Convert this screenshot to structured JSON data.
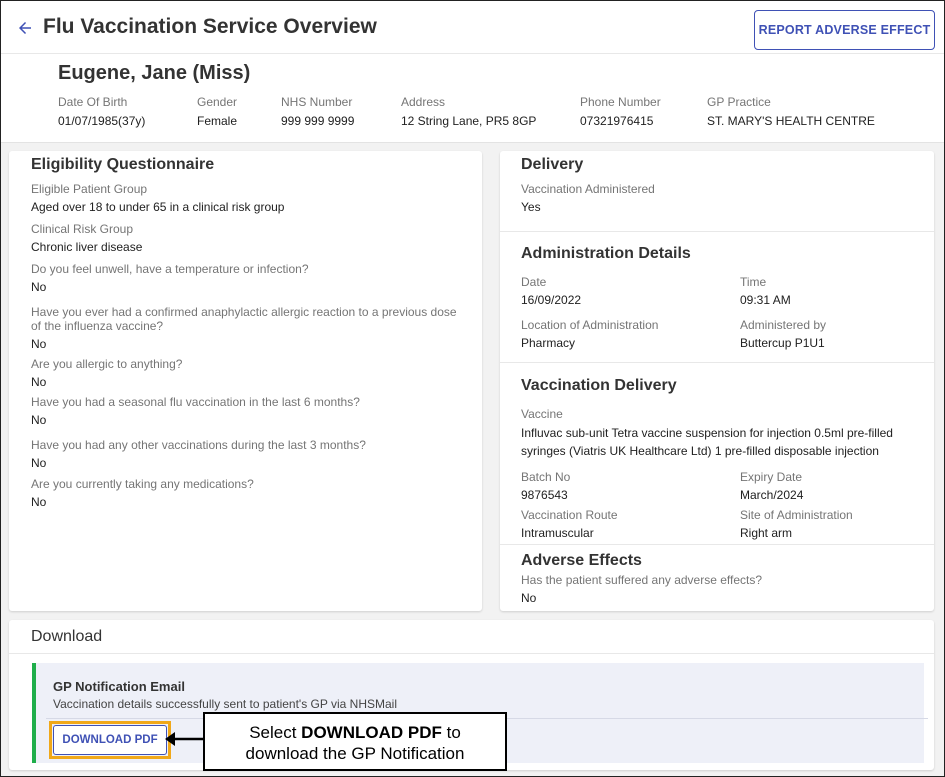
{
  "header": {
    "title": "Flu Vaccination Service Overview",
    "report_button": "REPORT ADVERSE EFFECT"
  },
  "patient": {
    "name": "Eugene, Jane (Miss)",
    "fields": [
      {
        "label": "Date Of Birth",
        "value": "01/07/1985(37y)"
      },
      {
        "label": "Gender",
        "value": "Female"
      },
      {
        "label": "NHS Number",
        "value": "999 999 9999"
      },
      {
        "label": "Address",
        "value": "12 String Lane, PR5 8GP"
      },
      {
        "label": "Phone Number",
        "value": "07321976415"
      },
      {
        "label": "GP Practice",
        "value": "ST. MARY'S HEALTH CENTRE"
      }
    ]
  },
  "eligibility": {
    "title": "Eligibility Questionnaire",
    "items": [
      {
        "q": "Eligible Patient Group",
        "a": "Aged over 18 to under 65 in a clinical risk group"
      },
      {
        "q": "Clinical Risk Group",
        "a": "Chronic liver disease"
      },
      {
        "q": "Do you feel unwell, have a temperature or infection?",
        "a": "No"
      },
      {
        "q": "Have you ever had a confirmed anaphylactic allergic reaction to a previous dose of the influenza vaccine?",
        "a": "No"
      },
      {
        "q": "Are you allergic to anything?",
        "a": "No"
      },
      {
        "q": "Have you had a seasonal flu vaccination in the last 6 months?",
        "a": "No"
      },
      {
        "q": "Have you had any other vaccinations during the last 3 months?",
        "a": "No"
      },
      {
        "q": "Are you currently taking any medications?",
        "a": "No"
      }
    ]
  },
  "delivery": {
    "title": "Delivery",
    "administered_label": "Vaccination Administered",
    "administered_value": "Yes"
  },
  "administration": {
    "title": "Administration Details",
    "date_label": "Date",
    "date_value": "16/09/2022",
    "time_label": "Time",
    "time_value": "09:31 AM",
    "location_label": "Location of Administration",
    "location_value": "Pharmacy",
    "by_label": "Administered by",
    "by_value": "Buttercup P1U1"
  },
  "vaccination_delivery": {
    "title": "Vaccination Delivery",
    "vaccine_label": "Vaccine",
    "vaccine_value": "Influvac sub-unit Tetra vaccine suspension for injection 0.5ml pre-filled syringes (Viatris UK Healthcare Ltd) 1 pre-filled disposable injection",
    "batch_label": "Batch No",
    "batch_value": "9876543",
    "expiry_label": "Expiry Date",
    "expiry_value": "March/2024",
    "route_label": "Vaccination Route",
    "route_value": "Intramuscular",
    "site_label": "Site of Administration",
    "site_value": "Right arm"
  },
  "adverse": {
    "title": "Adverse Effects",
    "question": "Has the patient suffered any adverse effects?",
    "answer": "No"
  },
  "download": {
    "title": "Download",
    "notification_title": "GP Notification Email",
    "notification_text": "Vaccination details successfully sent to patient's GP via NHSMail",
    "button": "DOWNLOAD PDF"
  },
  "callout": {
    "prefix": "Select ",
    "bold": "DOWNLOAD PDF",
    "suffix": " to",
    "line2": "download the GP Notification"
  },
  "colors": {
    "accent": "#3f51b5",
    "success_bar": "#1fae4b",
    "highlight": "#f0a81a"
  }
}
